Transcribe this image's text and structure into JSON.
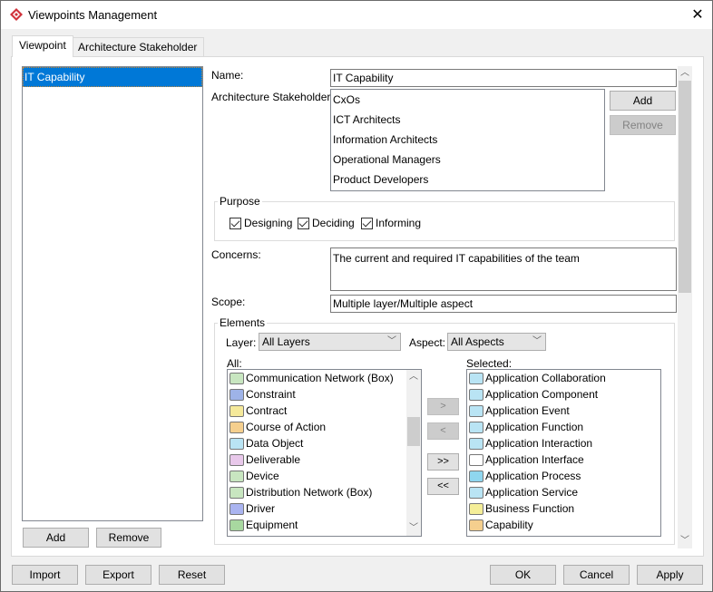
{
  "window": {
    "title": "Viewpoints Management"
  },
  "tabs": [
    {
      "label": "Viewpoint",
      "active": true
    },
    {
      "label": "Architecture Stakeholder",
      "active": false
    }
  ],
  "viewpoint_list": {
    "items": [
      "IT Capability"
    ],
    "selected": "IT Capability",
    "add_label": "Add",
    "remove_label": "Remove"
  },
  "form": {
    "name_label": "Name:",
    "name_value": "IT Capability",
    "stakeholders_label": "Architecture Stakeholders:",
    "stakeholders": [
      "CxOs",
      "ICT Architects",
      "Information Architects",
      "Operational Managers",
      "Product Developers"
    ],
    "stakeholder_add": "Add",
    "stakeholder_remove": "Remove",
    "purpose_title": "Purpose",
    "purposes": [
      {
        "label": "Designing",
        "checked": true
      },
      {
        "label": "Deciding",
        "checked": true
      },
      {
        "label": "Informing",
        "checked": true
      }
    ],
    "concerns_label": "Concerns:",
    "concerns_value": "The current and required IT capabilities of the team",
    "scope_label": "Scope:",
    "scope_value": "Multiple layer/Multiple aspect"
  },
  "elements": {
    "title": "Elements",
    "layer_label": "Layer:",
    "layer_value": "All Layers",
    "aspect_label": "Aspect:",
    "aspect_value": "All Aspects",
    "all_label": "All:",
    "selected_label": "Selected:",
    "all_items": [
      {
        "label": "Communication Network (Box)",
        "icon": "communication-network-icon",
        "color": "#c8e6c0"
      },
      {
        "label": "Constraint",
        "icon": "constraint-icon",
        "color": "#9eb3e8"
      },
      {
        "label": "Contract",
        "icon": "contract-icon",
        "color": "#f5e99a"
      },
      {
        "label": "Course of Action",
        "icon": "course-of-action-icon",
        "color": "#f5cf8e"
      },
      {
        "label": "Data Object",
        "icon": "data-object-icon",
        "color": "#b9e4f4"
      },
      {
        "label": "Deliverable",
        "icon": "deliverable-icon",
        "color": "#e8c8ea"
      },
      {
        "label": "Device",
        "icon": "device-icon",
        "color": "#c8e6c0"
      },
      {
        "label": "Distribution Network (Box)",
        "icon": "distribution-network-icon",
        "color": "#c8e6c0"
      },
      {
        "label": "Driver",
        "icon": "driver-icon",
        "color": "#aab4f0"
      },
      {
        "label": "Equipment",
        "icon": "equipment-icon",
        "color": "#a8d8a0"
      }
    ],
    "selected_items": [
      {
        "label": "Application Collaboration",
        "icon": "application-collaboration-icon",
        "color": "#b9e4f4"
      },
      {
        "label": "Application Component",
        "icon": "application-component-icon",
        "color": "#b9e4f4"
      },
      {
        "label": "Application Event",
        "icon": "application-event-icon",
        "color": "#b9e4f4"
      },
      {
        "label": "Application Function",
        "icon": "application-function-icon",
        "color": "#b9e4f4"
      },
      {
        "label": "Application Interaction",
        "icon": "application-interaction-icon",
        "color": "#b9e4f4"
      },
      {
        "label": "Application Interface",
        "icon": "application-interface-icon",
        "color": "#ffffff"
      },
      {
        "label": "Application Process",
        "icon": "application-process-icon",
        "color": "#8fd6ef"
      },
      {
        "label": "Application Service",
        "icon": "application-service-icon",
        "color": "#b9e4f4"
      },
      {
        "label": "Business Function",
        "icon": "business-function-icon",
        "color": "#f5ee98"
      },
      {
        "label": "Capability",
        "icon": "capability-icon",
        "color": "#f5cf8e"
      }
    ],
    "move_right": ">",
    "move_left": "<",
    "move_all_right": ">>",
    "move_all_left": "<<"
  },
  "footer": {
    "import": "Import",
    "export": "Export",
    "reset": "Reset",
    "ok": "OK",
    "cancel": "Cancel",
    "apply": "Apply"
  }
}
